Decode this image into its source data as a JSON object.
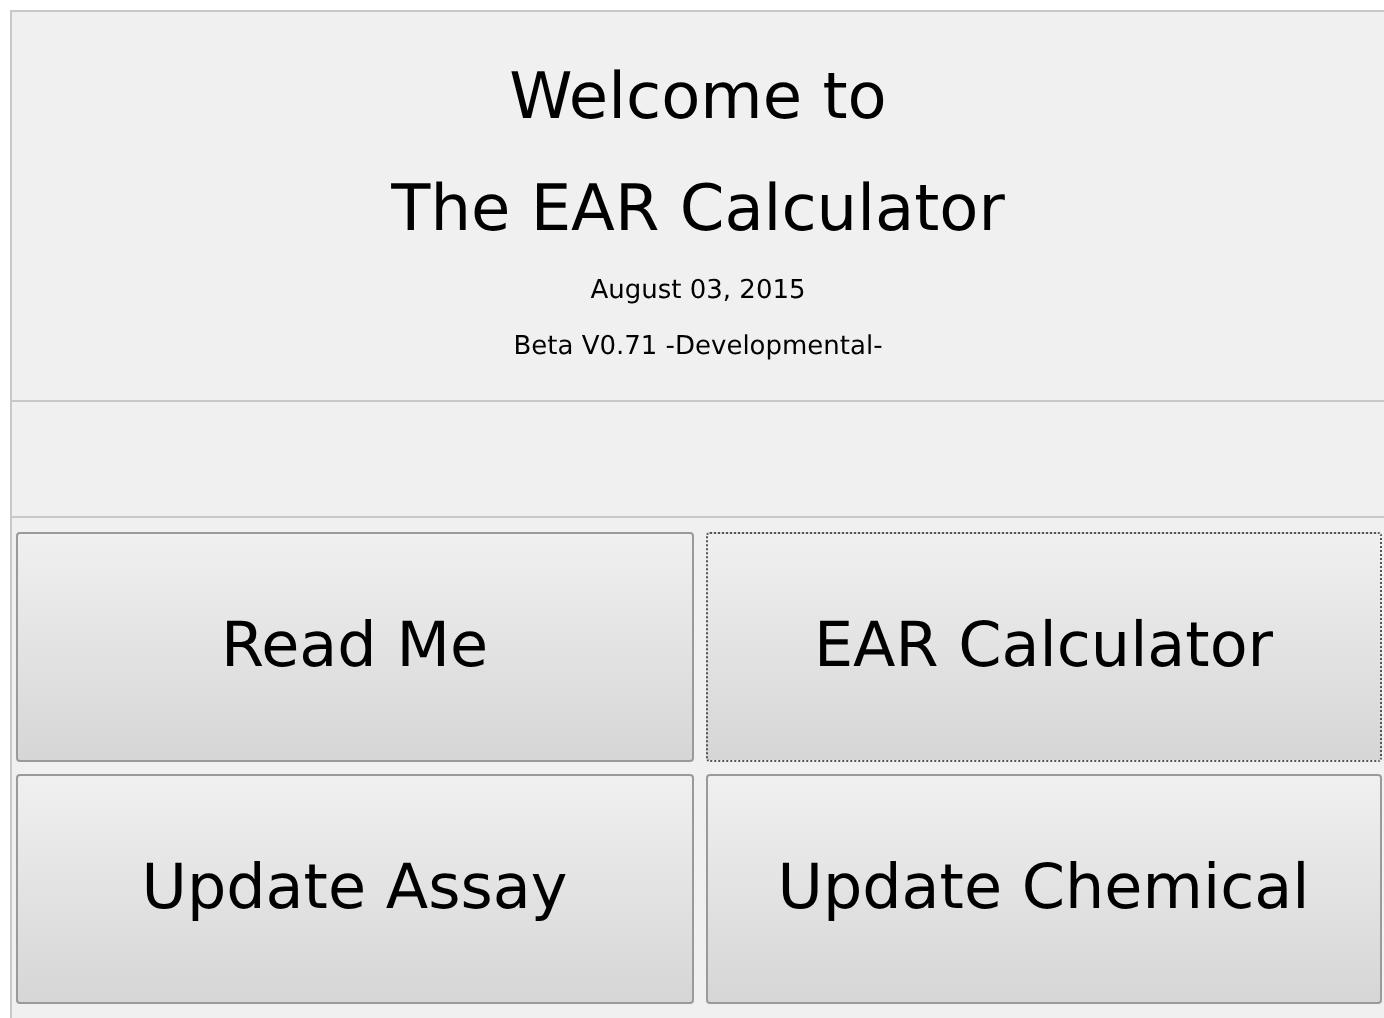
{
  "header": {
    "title_lines": [
      "Welcome to",
      "The EAR Calculator"
    ],
    "date": "August 03, 2015",
    "version": "Beta V0.71 -Developmental-"
  },
  "buttons": [
    {
      "label": "Read Me",
      "focused": false
    },
    {
      "label": "EAR Calculator",
      "focused": true
    },
    {
      "label": "Update Assay",
      "focused": false
    },
    {
      "label": "Update Chemical",
      "focused": false
    }
  ]
}
